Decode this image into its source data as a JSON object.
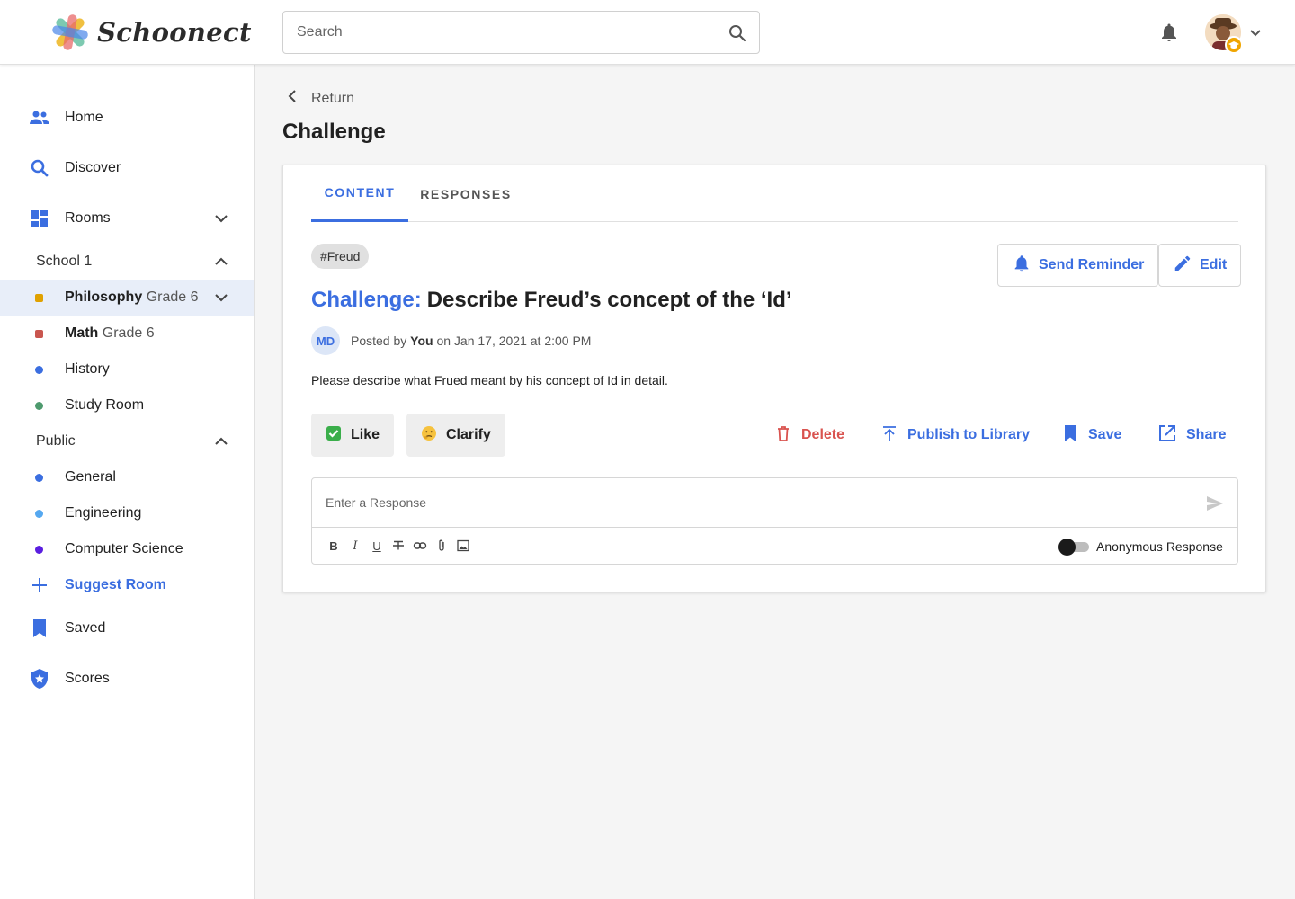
{
  "app": {
    "name": "Schoonect"
  },
  "header": {
    "search_placeholder": "Search"
  },
  "sidebar": {
    "home": "Home",
    "discover": "Discover",
    "rooms": "Rooms",
    "school_section": "School 1",
    "school_rooms": [
      {
        "name": "Philosophy",
        "grade": "Grade 6",
        "color": "#e0a100"
      },
      {
        "name": "Math",
        "grade": "Grade 6",
        "color": "#c9564f"
      },
      {
        "name": "History",
        "color": "#3b6ee0"
      },
      {
        "name": "Study Room",
        "color": "#4e9a6e"
      }
    ],
    "public_section": "Public",
    "public_rooms": [
      {
        "name": "General",
        "color": "#3b6ee0"
      },
      {
        "name": "Engineering",
        "color": "#55a8f0"
      },
      {
        "name": "Computer Science",
        "color": "#5a1ee0"
      }
    ],
    "suggest_room": "Suggest Room",
    "saved": "Saved",
    "scores": "Scores"
  },
  "page": {
    "return_label": "Return",
    "title": "Challenge"
  },
  "tabs": [
    "CONTENT",
    "RESPONSES"
  ],
  "post": {
    "tag": "#Freud",
    "send_reminder": "Send Reminder",
    "edit": "Edit",
    "title_prefix": "Challenge:",
    "title": "Describe Freud’s concept of the ‘Id’",
    "author_initials": "MD",
    "posted_by_label": "Posted by",
    "posted_by_name": "You",
    "posted_on": "on Jan 17, 2021 at 2:00 PM",
    "description": "Please describe what Frued meant by his concept of Id in detail.",
    "like": "Like",
    "clarify": "Clarify",
    "delete": "Delete",
    "publish": "Publish to Library",
    "save": "Save",
    "share": "Share"
  },
  "response": {
    "placeholder": "Enter a Response",
    "anonymous_label": "Anonymous Response",
    "format_tools": [
      "B",
      "I",
      "U"
    ]
  },
  "colors": {
    "accent": "#3b6ee0",
    "danger": "#d9534f"
  }
}
